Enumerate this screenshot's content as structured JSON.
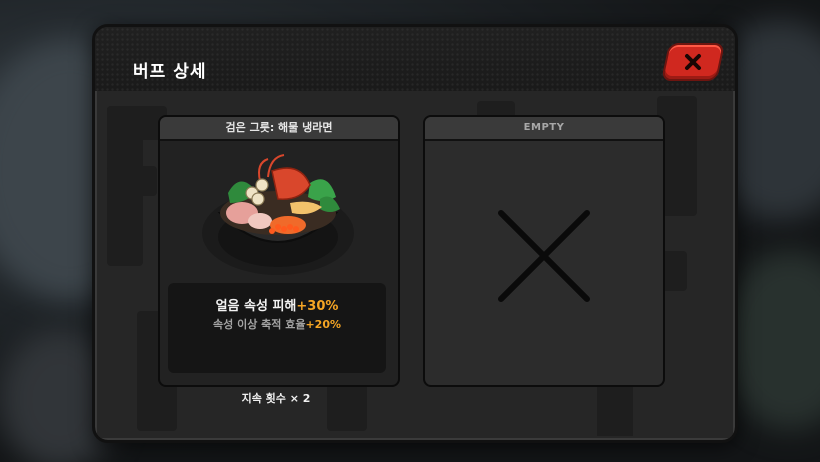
{
  "dialog": {
    "title": "버프 상세",
    "close_icon": "close-x-icon"
  },
  "slots": [
    {
      "header": "검은 그릇: 해물 냉라면",
      "icon": "seafood-cold-ramen-bowl-icon",
      "effect_main_label": "얼음 속성 피해",
      "effect_main_value": "+30%",
      "effect_sub_label": "속성 이상 축적 효율",
      "effect_sub_value": "+20%",
      "duration": "지속 횟수 × 2"
    },
    {
      "header": "EMPTY",
      "icon": "empty-x-icon"
    }
  ],
  "colors": {
    "accent": "#f5a524",
    "close_button": "#d0281f"
  }
}
